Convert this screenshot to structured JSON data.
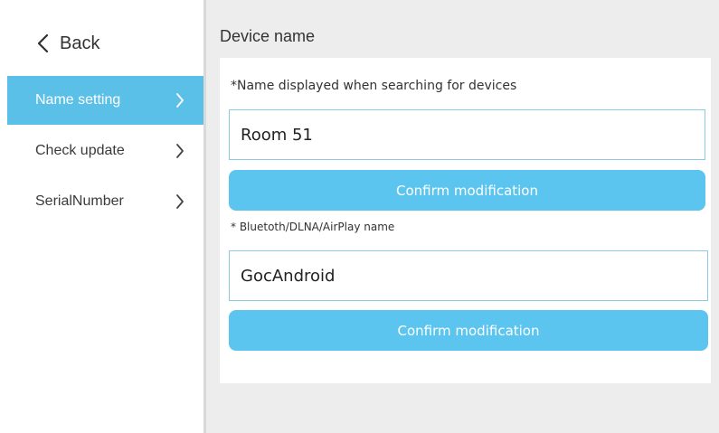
{
  "sidebar": {
    "back_label": "Back",
    "items": [
      {
        "label": "Name setting",
        "active": true
      },
      {
        "label": "Check update",
        "active": false
      },
      {
        "label": "SerialNumber",
        "active": false
      }
    ]
  },
  "main": {
    "title": "Device name",
    "device_name": {
      "label": "*Name displayed when searching for devices",
      "value": "Room 51",
      "confirm_label": "Confirm modification"
    },
    "bluetooth_name": {
      "label": "* Bluetoth/DLNA/AirPlay name",
      "value": "GocAndroid",
      "confirm_label": "Confirm modification"
    }
  },
  "colors": {
    "accent": "#5bc0e8",
    "button": "#5bc5ef",
    "background": "#ededed",
    "input_border": "#8ccbe3"
  },
  "icons": {
    "back": "chevron-left-icon",
    "nav": "chevron-right-icon"
  }
}
